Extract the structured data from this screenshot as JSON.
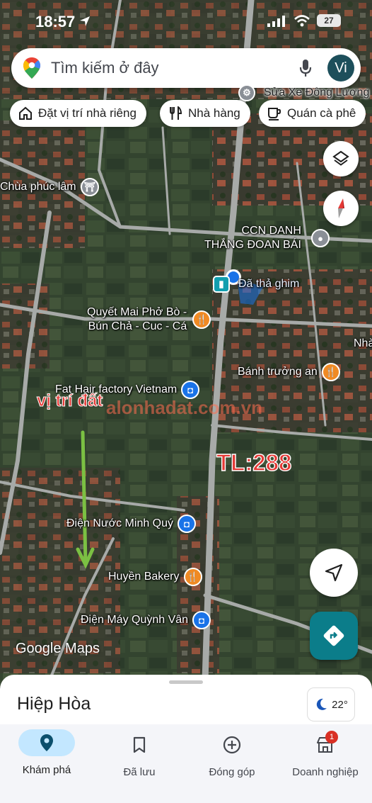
{
  "status_bar": {
    "time": "18:57",
    "battery": "27"
  },
  "search": {
    "placeholder": "Tìm kiếm ở đây",
    "avatar_initials": "Vi"
  },
  "chips": [
    {
      "label": "Đặt vị trí nhà riêng",
      "icon": "home-icon"
    },
    {
      "label": "Nhà hàng",
      "icon": "fork-knife-icon"
    },
    {
      "label": "Quán cà phê",
      "icon": "coffee-cup-icon"
    }
  ],
  "map": {
    "pois": {
      "sua_xe": "Sửa Xe Đông Lương",
      "chua_phuc_lam": "Chùa phúc lâm",
      "ccn_line1": "CCN DANH",
      "ccn_line2": "THẮNG ĐOAN BÁI",
      "dropped_pin": "Đã thả ghim",
      "quyet_mai_line1": "Quyết Mai Phở Bò -",
      "quyet_mai_line2": "Bún Chả - Cuc - Cá",
      "nha_edge": "Nhà",
      "banh_truong_an": "Bánh trưởng an",
      "fat_hair": "Fat Hair factory Vietnam",
      "dien_nuoc": "Điện Nước Minh Quý",
      "huyen_bakery": "Huyền Bakery",
      "dien_may": "Điện Máy Quỳnh Vân"
    },
    "overlay": {
      "land_label": "vị trí đất",
      "road_label": "TL:288",
      "watermark": "alonhadat.com.vn"
    },
    "attribution": "Google Maps"
  },
  "bottom_sheet": {
    "place_name": "Hiệp Hòa",
    "weather": "22°"
  },
  "nav": [
    {
      "label": "Khám phá",
      "icon": "explore-pin-icon",
      "active": true
    },
    {
      "label": "Đã lưu",
      "icon": "bookmark-icon"
    },
    {
      "label": "Đóng góp",
      "icon": "add-circle-icon"
    },
    {
      "label": "Doanh nghiệp",
      "icon": "business-icon",
      "badge": "1"
    }
  ],
  "colors": {
    "accent": "#1a73e8",
    "overlay_red": "#e53935",
    "overlay_green": "#7bc043",
    "nav_active": "#c3e7ff",
    "directions_fab": "#0b7d8a"
  }
}
